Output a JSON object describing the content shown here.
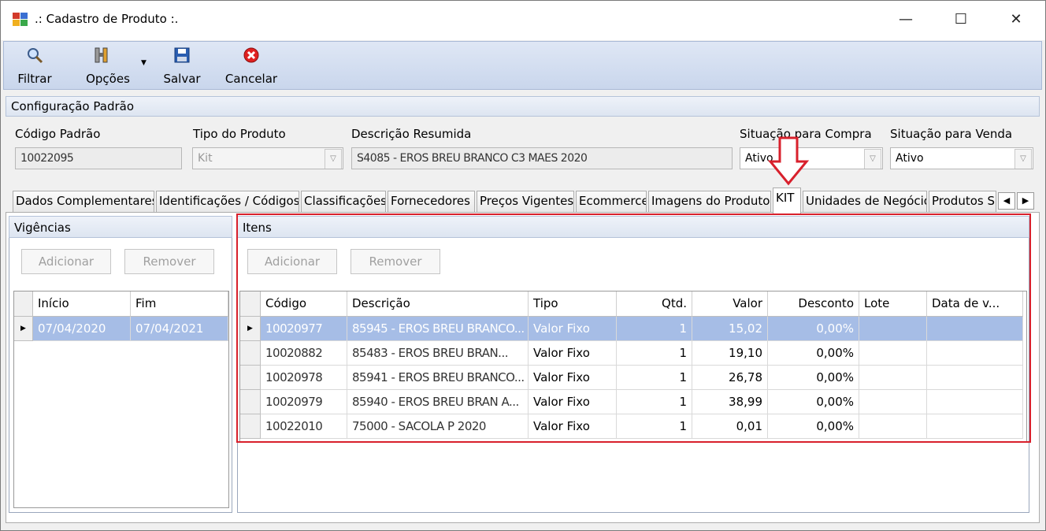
{
  "window": {
    "title": ".: Cadastro de Produto :.",
    "minimize": "—",
    "maximize": "☐",
    "close": "✕"
  },
  "toolbar": {
    "filtrar": "Filtrar",
    "opcoes": "Opções",
    "salvar": "Salvar",
    "cancelar": "Cancelar"
  },
  "config": {
    "header": "Configuração Padrão",
    "codigo_label": "Código Padrão",
    "codigo_value": "10022095",
    "tipo_label": "Tipo do Produto",
    "tipo_value": "Kit",
    "descricao_label": "Descrição Resumida",
    "descricao_value": "S4085 - EROS BREU BRANCO C3 MAES 2020",
    "sit_compra_label": "Situação para Compra",
    "sit_compra_value": "Ativo",
    "sit_venda_label": "Situação para Venda",
    "sit_venda_value": "Ativo"
  },
  "tabs": [
    "Dados Complementares",
    "Identificações / Códigos",
    "Classificações",
    "Fornecedores",
    "Preços Vigentes",
    "Ecommerce",
    "Imagens do Produto",
    "KIT",
    "Unidades de Negócio",
    "Produtos S"
  ],
  "vigencias": {
    "header": "Vigências",
    "adicionar": "Adicionar",
    "remover": "Remover",
    "columns": [
      "Início",
      "Fim"
    ],
    "rows": [
      [
        "07/04/2020",
        "07/04/2021"
      ]
    ]
  },
  "itens": {
    "header": "Itens",
    "adicionar": "Adicionar",
    "remover": "Remover",
    "columns": [
      "Código",
      "Descrição",
      "Tipo",
      "Qtd.",
      "Valor",
      "Desconto",
      "Lote",
      "Data de v..."
    ],
    "rows": [
      [
        "10020977",
        "85945 - EROS BREU BRANCO...",
        "Valor Fixo",
        "1",
        "15,02",
        "0,00%",
        "",
        ""
      ],
      [
        "10020882",
        "85483 - EROS BREU BRAN...",
        "Valor Fixo",
        "1",
        "19,10",
        "0,00%",
        "",
        ""
      ],
      [
        "10020978",
        "85941 - EROS BREU BRANCO...",
        "Valor Fixo",
        "1",
        "26,78",
        "0,00%",
        "",
        ""
      ],
      [
        "10020979",
        "85940 - EROS BREU BRAN A...",
        "Valor Fixo",
        "1",
        "38,99",
        "0,00%",
        "",
        ""
      ],
      [
        "10022010",
        "75000 - SACOLA P 2020",
        "Valor Fixo",
        "1",
        "0,01",
        "0,00%",
        "",
        ""
      ]
    ]
  },
  "colors": {
    "highlight": "#d8202c",
    "selection": "#a6bde6",
    "toolbar": "#cfdaee"
  }
}
